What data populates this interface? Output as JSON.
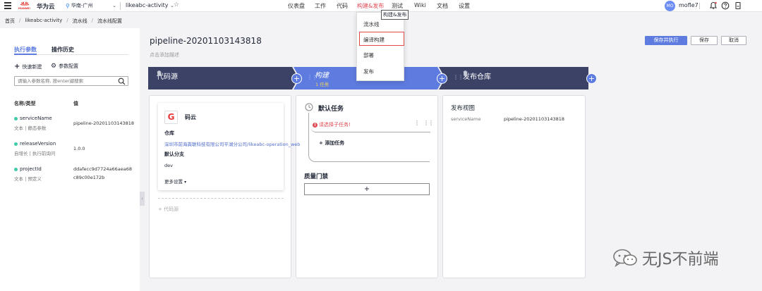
{
  "topnav": {
    "brand": "华为云",
    "logo_text": "HUAWEI",
    "region": "华南-广州",
    "project": "likeabc-activity",
    "menu": [
      {
        "label": "仪表盘"
      },
      {
        "label": "工作"
      },
      {
        "label": "代码"
      },
      {
        "label": "构建&发布",
        "active": true
      },
      {
        "label": "测试"
      },
      {
        "label": "Wiki"
      },
      {
        "label": "文档"
      },
      {
        "label": "设置"
      }
    ],
    "avatar_initials": "MO",
    "username": "mofle7",
    "icons": [
      "bell-icon",
      "help-icon",
      "device-icon"
    ]
  },
  "breadcrumb": [
    "首页",
    "likeabc-activity",
    "流水线",
    "流水线配置"
  ],
  "left": {
    "tabs": [
      "执行参数",
      "操作历史"
    ],
    "actions": [
      "快速新建",
      "参数配置"
    ],
    "search_placeholder": "请输入参数名称, 按enter键搜索",
    "headers": {
      "name": "名称/类型",
      "value": "值"
    },
    "params": [
      {
        "name": "serviceName",
        "sub": "文本 | 静态参数",
        "value": [
          "pipeline-20201103143818"
        ]
      },
      {
        "name": "releaseVersion",
        "sub": "自增长 | 执行前询问",
        "value": [
          "1.0.0"
        ]
      },
      {
        "name": "projectId",
        "sub": "文本 | 预定义",
        "value": [
          "ddafecc9d7724a66aea68",
          "c89c00e172b"
        ]
      }
    ]
  },
  "main": {
    "title": "pipeline-20201103143818",
    "desc": "点击添加描述",
    "buttons": {
      "save_run": "保存并执行",
      "save": "保存",
      "cancel": "取消"
    },
    "stages": [
      {
        "label": "代码源"
      },
      {
        "label": "构建",
        "sub": "1 任务"
      },
      {
        "label": "发布仓库"
      }
    ],
    "repo": {
      "logo": "G",
      "name": "码云",
      "repo_label": "仓库",
      "repo_value": "深圳市前海粪联科技有限公司平湖分公司/likeabc-operation_web",
      "branch_label": "默认分支",
      "branch_value": "dev",
      "more": "更多设置",
      "add_source": "+ 代码源"
    },
    "tasks": {
      "title": "默认任务",
      "warning": "请选择子任务!",
      "add_task": "添加任务",
      "gate_title": "质量门禁",
      "gate_plus": "+"
    },
    "release": {
      "title": "发布视图",
      "key": "serviceName",
      "value": "pipeline-20201103143818"
    }
  },
  "dropdown": {
    "tooltip": "构建&发布",
    "items": [
      "流水线",
      "编译构建",
      "部署",
      "发布"
    ],
    "highlighted": "编译构建"
  },
  "watermark": "无JS不前端",
  "colors": {
    "accent": "#5e7ce0",
    "dark_stage": "#3b4266",
    "active_menu": "#e04a54",
    "warn": "#e04a54"
  }
}
